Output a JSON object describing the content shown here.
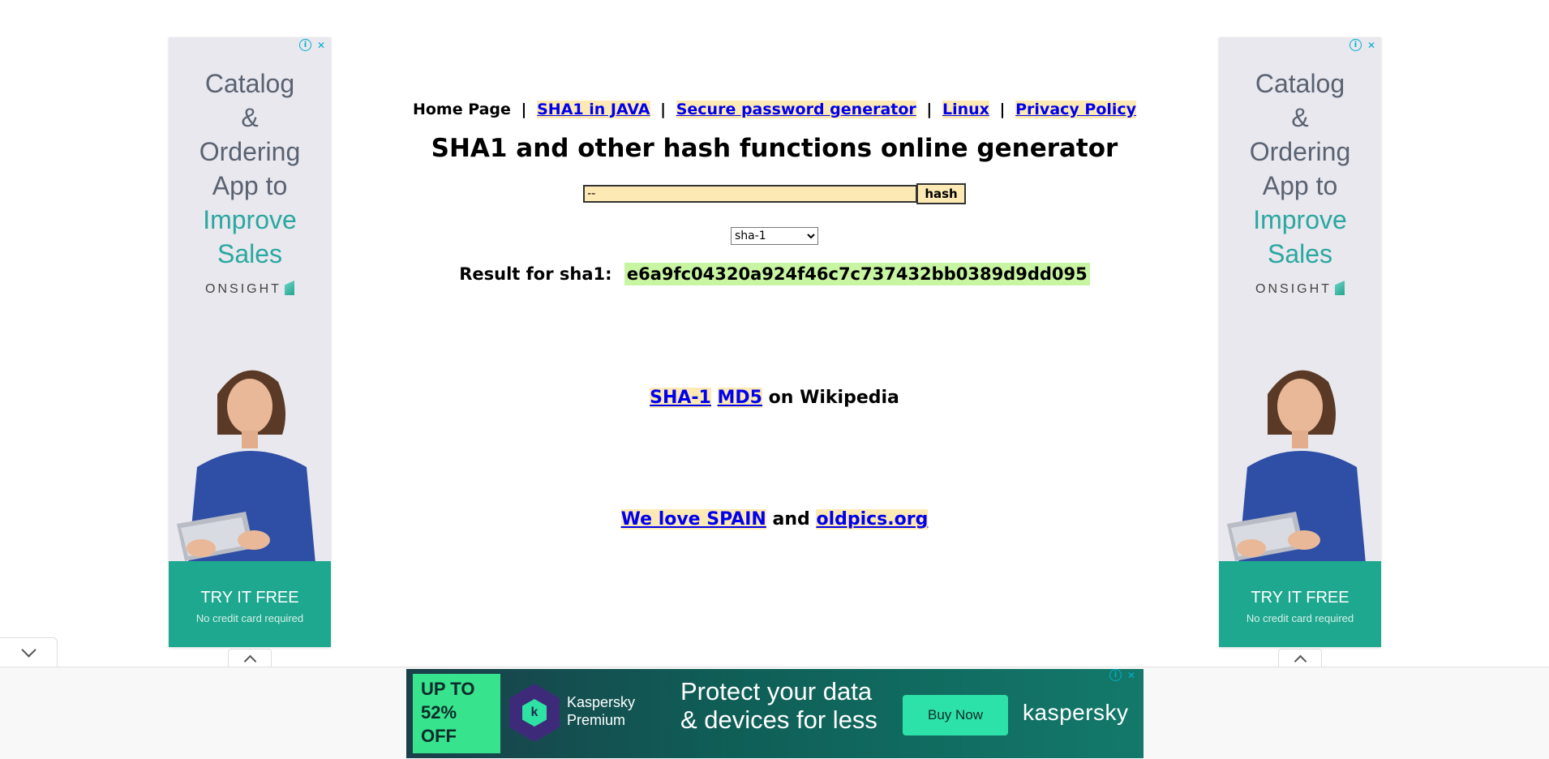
{
  "nav": {
    "home": "Home Page",
    "links": [
      "SHA1 in JAVA",
      "Secure password generator",
      "Linux",
      "Privacy Policy"
    ],
    "separator": "|"
  },
  "page_title": "SHA1 and other hash functions online generator",
  "form": {
    "input_value": "--",
    "hash_button": "hash",
    "algorithm_selected": "sha-1"
  },
  "result": {
    "label": "Result for sha1:",
    "value": "e6a9fc04320a924f46c7c737432bb0389d9dd095"
  },
  "wiki": {
    "link1": "SHA-1",
    "link2": "MD5",
    "suffix": "on Wikipedia"
  },
  "footer_links": {
    "link1": "We love SPAIN",
    "conjunction": "and",
    "link2": "oldpics.org"
  },
  "side_ad": {
    "headline_lines": [
      "Catalog",
      "&",
      "Ordering",
      "App to",
      "Improve",
      "Sales"
    ],
    "brand": "ONSIGHT",
    "cta": "TRY IT FREE",
    "cta_sub": "No credit card required"
  },
  "bottom_ad": {
    "promo": "UP TO 52% OFF",
    "logo_letter": "k",
    "product": "Kaspersky Premium",
    "headline": "Protect your data & devices for less",
    "button": "Buy Now",
    "brand": "kaspersky"
  },
  "icons": {
    "info": "ⓘ",
    "close": "✕"
  },
  "colors": {
    "link_bg": "#fde9b3",
    "result_bg": "#c8f5a2",
    "ad_accent": "#1ea88f",
    "banner_button": "#2de2a8"
  }
}
